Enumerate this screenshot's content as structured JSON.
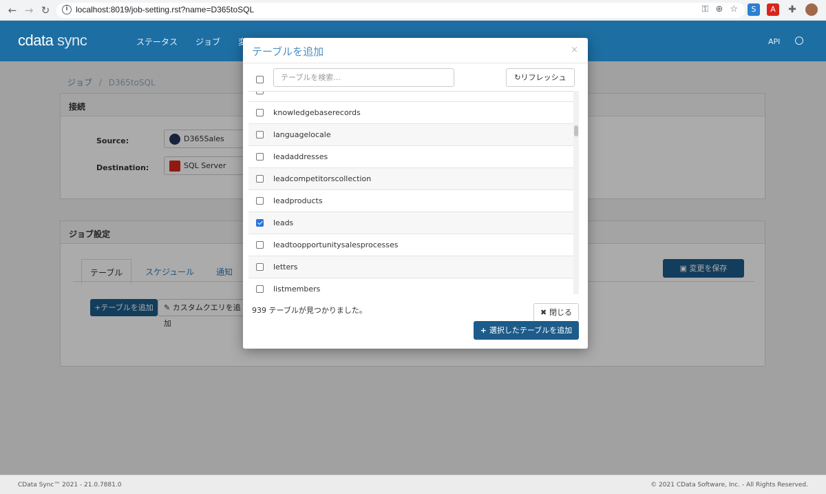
{
  "browser": {
    "url": "localhost:8019/job-setting.rst?name=D365toSQL"
  },
  "header": {
    "logo_main": "cdata",
    "logo_sync": "sync",
    "nav": [
      "ステータス",
      "ジョブ",
      "変換"
    ],
    "api": "API"
  },
  "page": {
    "breadcrumb_jobs": "ジョブ",
    "breadcrumb_sep": "/",
    "breadcrumb_current": "D365toSQL",
    "connection_title": "接続",
    "source_label": "Source:",
    "source_value": "D365Sales",
    "destination_label": "Destination:",
    "destination_value": "SQL Server",
    "job_settings_title": "ジョブ設定",
    "tabs": [
      "テーブル",
      "スケジュール",
      "通知"
    ],
    "save_button": "変更を保存",
    "add_table_button": "テーブルを追加",
    "custom_query_button": "カスタムクエリを追加"
  },
  "footer": {
    "left": "CData Sync™ 2021 - 21.0.7881.0",
    "right": "© 2021 CData Software, Inc. - All Rights Reserved."
  },
  "modal": {
    "title": "テーブルを追加",
    "search_placeholder": "テーブルを検索...",
    "refresh_label": "リフレッシュ",
    "rows": [
      {
        "label": "knowledgebaserecords",
        "checked": false
      },
      {
        "label": "languagelocale",
        "checked": false
      },
      {
        "label": "leadaddresses",
        "checked": false
      },
      {
        "label": "leadcompetitorscollection",
        "checked": false
      },
      {
        "label": "leadproducts",
        "checked": false
      },
      {
        "label": "leads",
        "checked": true
      },
      {
        "label": "leadtoopportunitysalesprocesses",
        "checked": false
      },
      {
        "label": "letters",
        "checked": false
      },
      {
        "label": "listmembers",
        "checked": false
      }
    ],
    "found_count": "939 テーブルが見つかりました。",
    "close_label": "閉じる",
    "add_selected_label": "選択したテーブルを追加"
  },
  "colors": {
    "brand": "#1d6ea3",
    "primary_button": "#1d5c8a",
    "checkbox_checked": "#2a73d9"
  }
}
